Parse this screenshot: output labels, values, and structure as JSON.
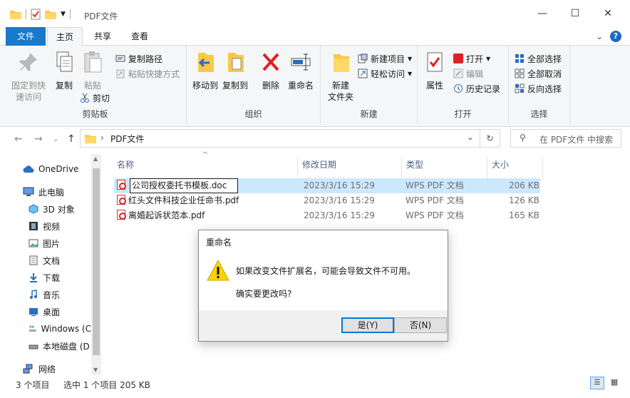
{
  "window": {
    "title": "PDF文件"
  },
  "tabs": [
    "文件",
    "主页",
    "共享",
    "查看"
  ],
  "ribbon": {
    "clipboard": {
      "label": "剪贴板",
      "pin": "固定到快\n速访问",
      "copy": "复制",
      "paste": "粘贴",
      "copy_path": "复制路径",
      "paste_shortcut": "粘贴快捷方式",
      "cut": "剪切"
    },
    "organize": {
      "label": "组织",
      "move_to": "移动到",
      "copy_to": "复制到",
      "delete": "删除",
      "rename": "重命名"
    },
    "new": {
      "label": "新建",
      "new_folder": "新建\n文件夹",
      "new_item": "新建项目",
      "easy_access": "轻松访问"
    },
    "open": {
      "label": "打开",
      "properties": "属性",
      "open": "打开",
      "edit": "编辑",
      "history": "历史记录"
    },
    "select": {
      "label": "选择",
      "select_all": "全部选择",
      "select_none": "全部取消",
      "invert": "反向选择"
    }
  },
  "address": {
    "path": "PDF文件",
    "search_placeholder": "在 PDF文件 中搜索"
  },
  "nav": [
    "OneDrive",
    "此电脑",
    "3D 对象",
    "视频",
    "图片",
    "文档",
    "下载",
    "音乐",
    "桌面",
    "Windows (C",
    "本地磁盘 (D",
    "网络"
  ],
  "columns": [
    "名称",
    "修改日期",
    "类型",
    "大小"
  ],
  "files": [
    {
      "name": "公司授权委托书模板.doc",
      "date": "2023/3/16 15:29",
      "type": "WPS PDF 文档",
      "size": "206 KB"
    },
    {
      "name": "红头文件科技企业任命书.pdf",
      "date": "2023/3/16 15:29",
      "type": "WPS PDF 文档",
      "size": "126 KB"
    },
    {
      "name": "离婚起诉状范本.pdf",
      "date": "2023/3/16 15:29",
      "type": "WPS PDF 文档",
      "size": "165 KB"
    }
  ],
  "status": {
    "count": "3 个项目",
    "selected": "选中 1 个项目  205 KB"
  },
  "dialog": {
    "title": "重命名",
    "message": "如果改变文件扩展名，可能会导致文件不可用。",
    "question": "确实要更改吗?",
    "yes": "是(Y)",
    "no": "否(N)"
  }
}
